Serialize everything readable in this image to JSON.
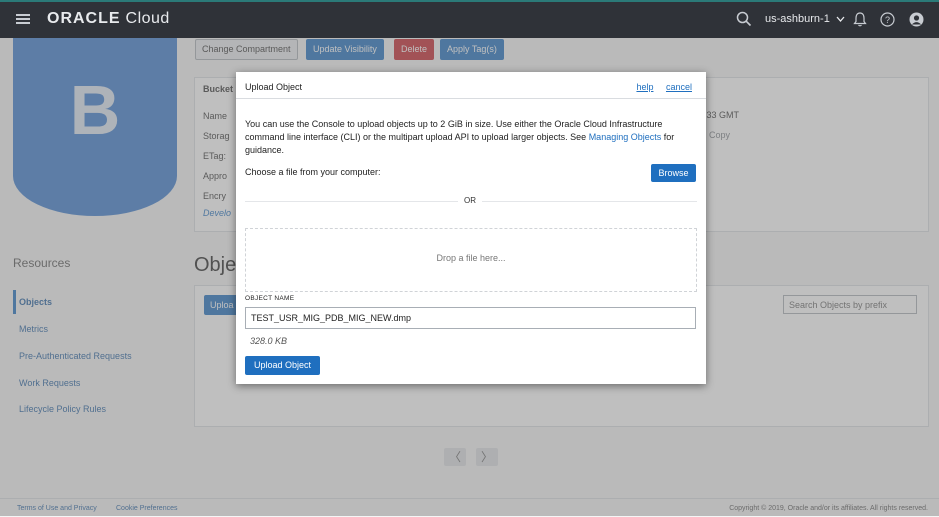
{
  "topbar": {
    "brand_main": "ORACLE",
    "brand_sub": "Cloud",
    "region": "us-ashburn-1",
    "icons": [
      "menu-icon",
      "search-icon",
      "chevron-down-icon",
      "bell-icon",
      "help-icon",
      "user-icon"
    ]
  },
  "bucket": {
    "avatar_letter": "B",
    "actions": [
      "Change Compartment",
      "Update Visibility",
      "Delete",
      "Apply Tag(s)"
    ],
    "info_header": "Bucket",
    "info_labels": [
      "Name",
      "Storag",
      "ETag:",
      "Appro",
      "Encry"
    ],
    "time_fragment": ":33 GMT",
    "copy_label": "Copy",
    "dev_link": "Develo"
  },
  "resources": {
    "title": "Resources",
    "items": [
      "Objects",
      "Metrics",
      "Pre-Authenticated Requests",
      "Work Requests",
      "Lifecycle Policy Rules"
    ],
    "active": "Objects"
  },
  "objects": {
    "title": "Obje",
    "upload_label": "Uploa",
    "search_placeholder": "Search Objects by prefix"
  },
  "pager": {
    "prev": "〈",
    "next": "〉"
  },
  "footer": {
    "terms": "Terms of Use and Privacy",
    "cookies": "Cookie Preferences",
    "copyright": "Copyright © 2019, Oracle and/or its affiliates. All rights reserved."
  },
  "modal": {
    "title": "Upload Object",
    "help": "help",
    "cancel": "cancel",
    "desc_before": "You can use the Console to upload objects up to 2 GiB in size. Use either the Oracle Cloud Infrastructure command line interface (CLI) or the multipart upload API to upload larger objects. See ",
    "desc_link": "Managing Objects",
    "desc_after": " for guidance.",
    "choose": "Choose a file from your computer:",
    "browse": "Browse",
    "or": "OR",
    "drop": "Drop a file here...",
    "object_name_label": "OBJECT NAME",
    "object_name_value": "TEST_USR_MIG_PDB_MIG_NEW.dmp",
    "file_size": "328.0 KB",
    "upload_button": "Upload Object"
  }
}
